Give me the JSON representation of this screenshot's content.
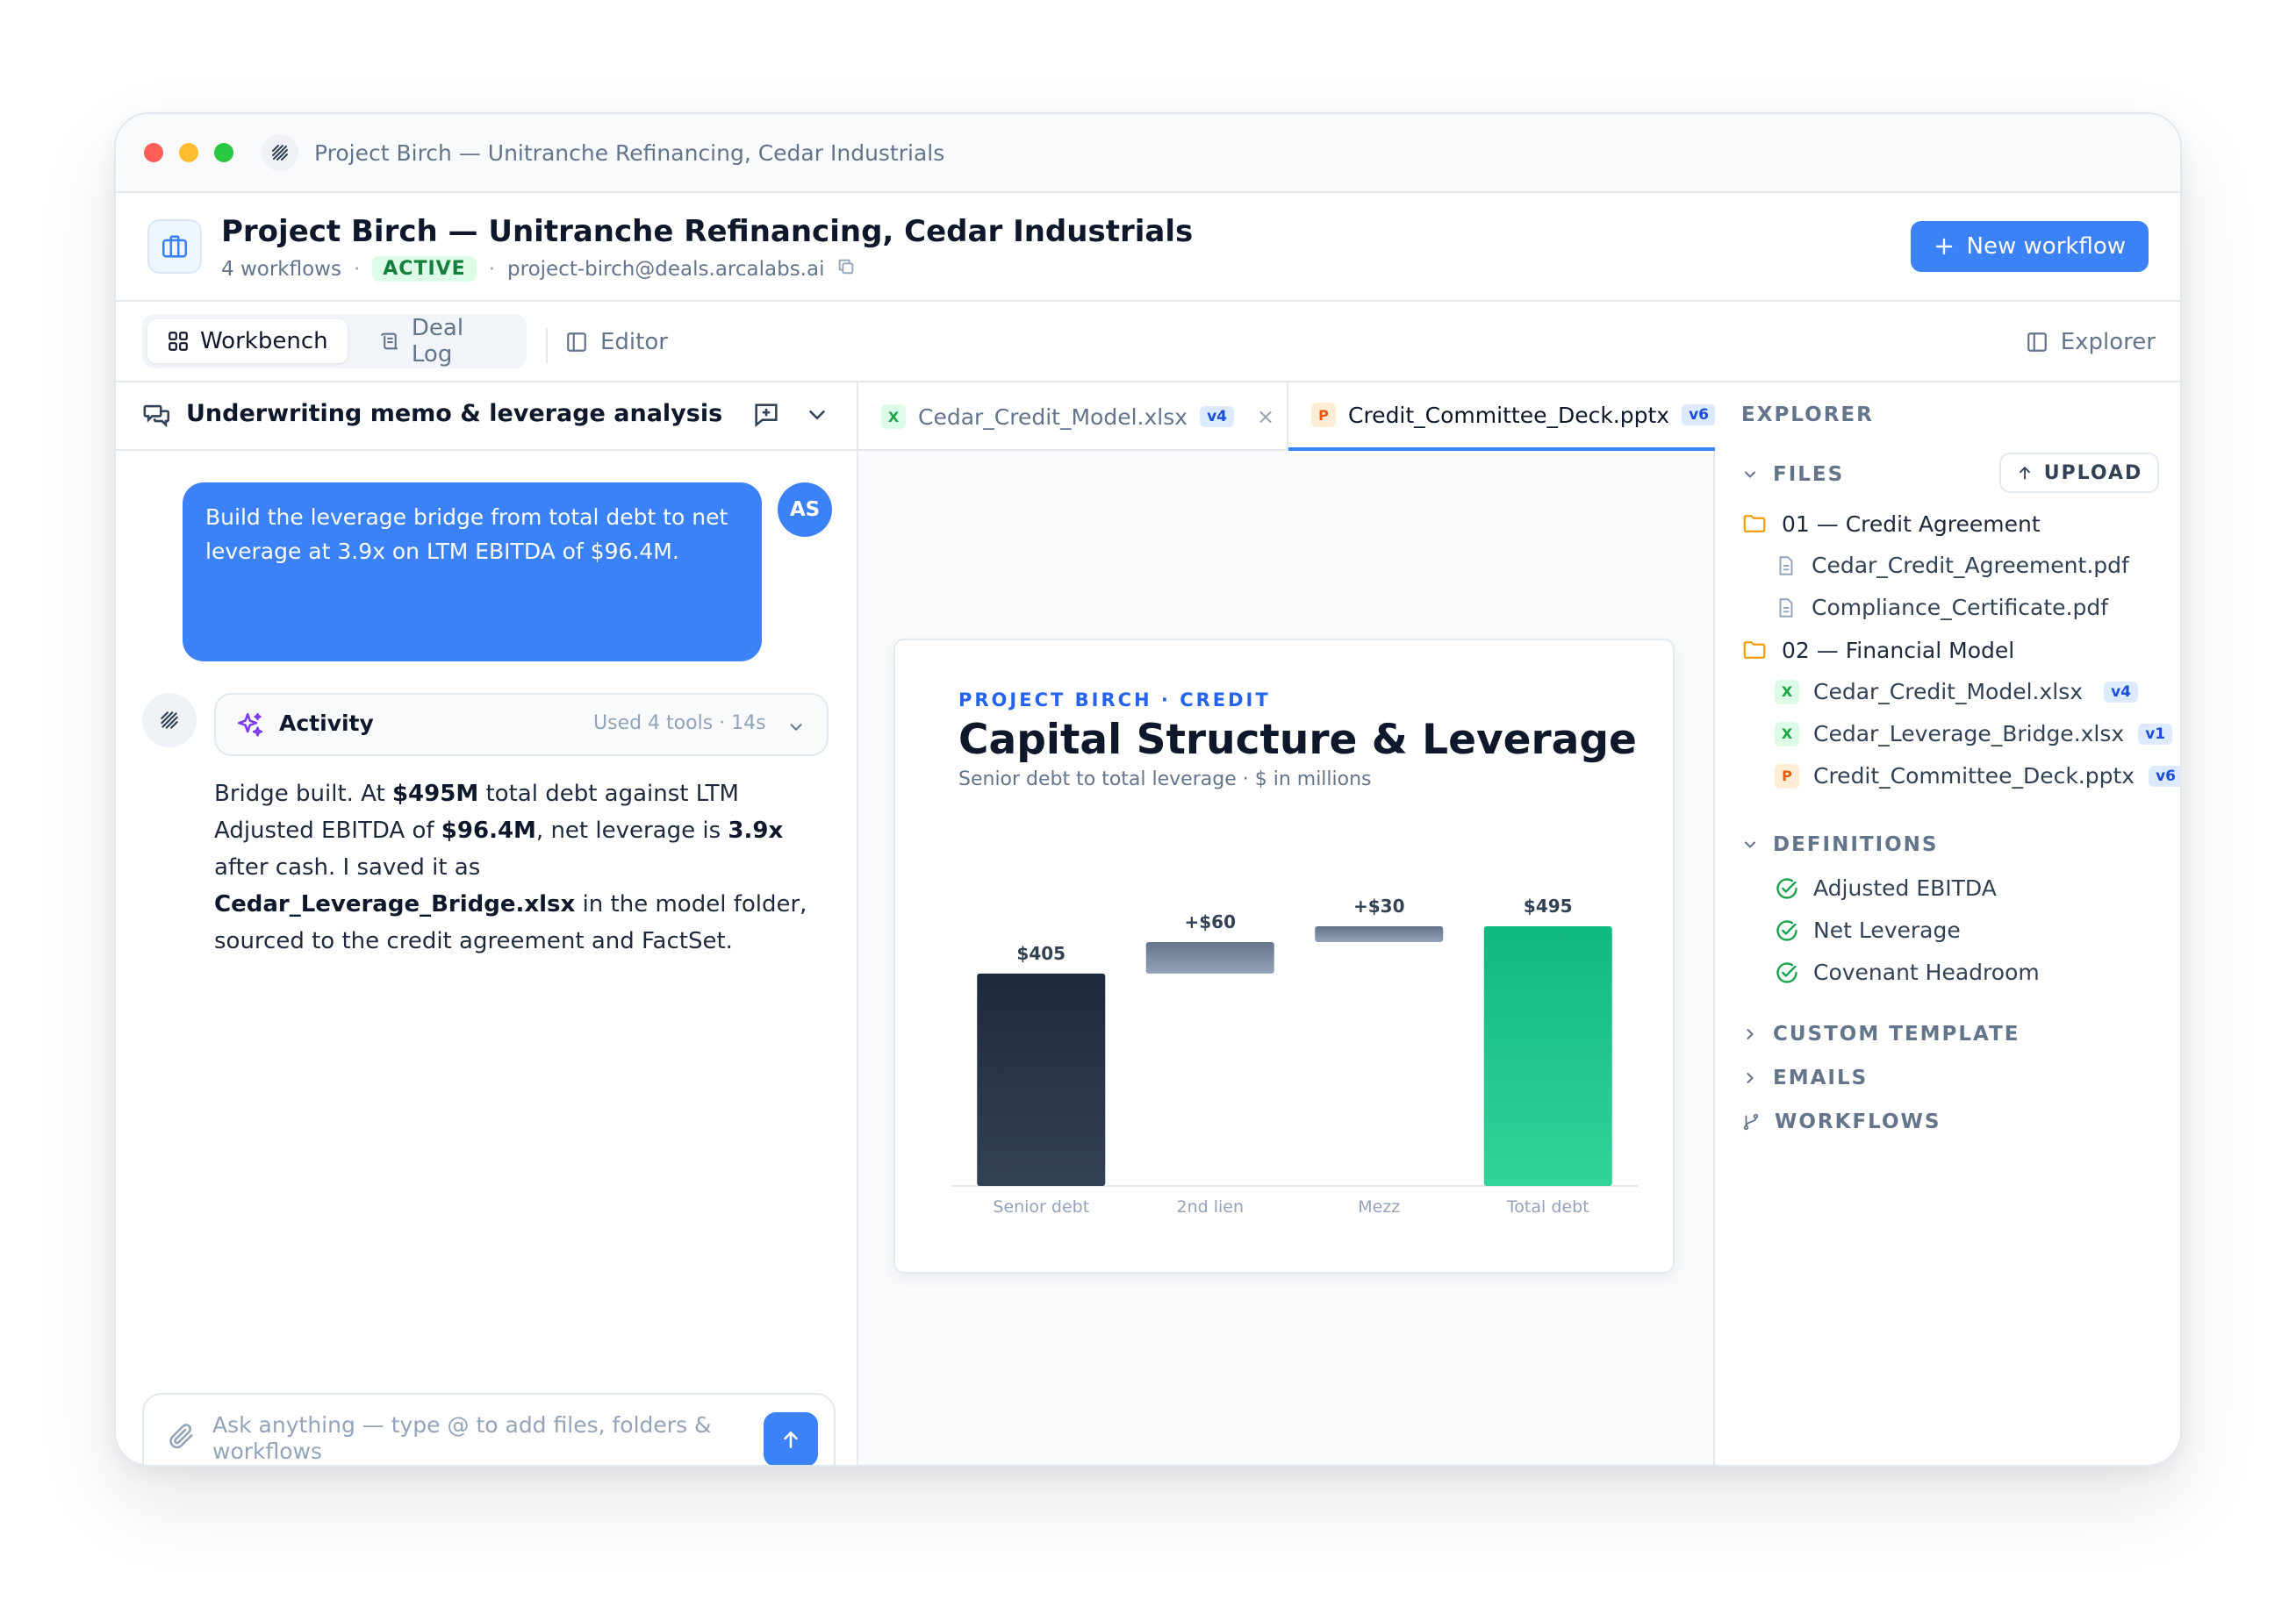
{
  "window": {
    "title": "Project Birch — Unitranche Refinancing, Cedar Industrials"
  },
  "header": {
    "title": "Project Birch — Unitranche Refinancing, Cedar Industrials",
    "workflows": "4 workflows",
    "status": "ACTIVE",
    "email": "project-birch@deals.arcalabs.ai",
    "new_button": "New workflow",
    "colors": {
      "accent": "#3b82f6",
      "active_bg": "#dcfce7",
      "active_fg": "#15803d"
    }
  },
  "toolbar": {
    "workbench": "Workbench",
    "deal_log": "Deal Log",
    "editor": "Editor",
    "explorer": "Explorer"
  },
  "chat": {
    "title": "Underwriting memo & leverage analysis",
    "user_initials": "AS",
    "user_message": "Build the leverage bridge from total debt to net leverage at 3.9x on LTM EBITDA of $96.4M.",
    "activity_label": "Activity",
    "activity_meta": "Used 4 tools · 14s",
    "answer": {
      "t1": "Bridge built. At ",
      "b1": "$495M",
      "t2": " total debt against LTM Adjusted EBITDA of ",
      "b2": "$96.4M",
      "t3": ", net leverage is ",
      "b3": "3.9x",
      "t4": " after cash. I saved it as ",
      "b4": "Cedar_Leverage_Bridge.xlsx",
      "t5": " in the model folder, sourced to the credit agreement and FactSet."
    },
    "composer_placeholder": "Ask anything — type @ to add files, folders & workflows"
  },
  "editor": {
    "tabs": [
      {
        "name": "Cedar_Credit_Model.xlsx",
        "icon": "X",
        "version": "v4"
      },
      {
        "name": "Credit_Committee_Deck.pptx",
        "icon": "P",
        "version": "v6"
      }
    ],
    "slide": {
      "eyebrow": "PROJECT BIRCH · CREDIT",
      "title": "Capital Structure & Leverage",
      "subtitle": "Senior debt to total leverage · $ in millions"
    }
  },
  "chart_data": {
    "type": "bar",
    "subtype": "waterfall",
    "categories": [
      "Senior debt",
      "2nd lien",
      "Mezz",
      "Total debt"
    ],
    "values": [
      405,
      60,
      30,
      495
    ],
    "labels": [
      "$405",
      "+$60",
      "+$30",
      "$495"
    ],
    "ylim": [
      0,
      495
    ],
    "grid": false,
    "colors": {
      "start": "#1e293b",
      "step": "#64748b",
      "total": "#10b981"
    }
  },
  "explorer": {
    "title": "EXPLORER",
    "files_label": "FILES",
    "upload_label": "UPLOAD",
    "folders": [
      {
        "name": "01 — Credit Agreement",
        "files": [
          {
            "name": "Cedar_Credit_Agreement.pdf",
            "icon": "document-icon"
          },
          {
            "name": "Compliance_Certificate.pdf",
            "icon": "document-icon"
          }
        ]
      },
      {
        "name": "02 — Financial Model",
        "files": [
          {
            "name": "Cedar_Credit_Model.xlsx",
            "icon": "X",
            "version": "v4"
          },
          {
            "name": "Cedar_Leverage_Bridge.xlsx",
            "icon": "X",
            "version": "v1"
          },
          {
            "name": "Credit_Committee_Deck.pptx",
            "icon": "P",
            "version": "v6"
          }
        ]
      }
    ],
    "definitions_label": "DEFINITIONS",
    "definitions": [
      "Adjusted EBITDA",
      "Net Leverage",
      "Covenant Headroom"
    ],
    "custom_template_label": "CUSTOM TEMPLATE",
    "emails_label": "EMAILS",
    "workflows_label": "WORKFLOWS"
  }
}
